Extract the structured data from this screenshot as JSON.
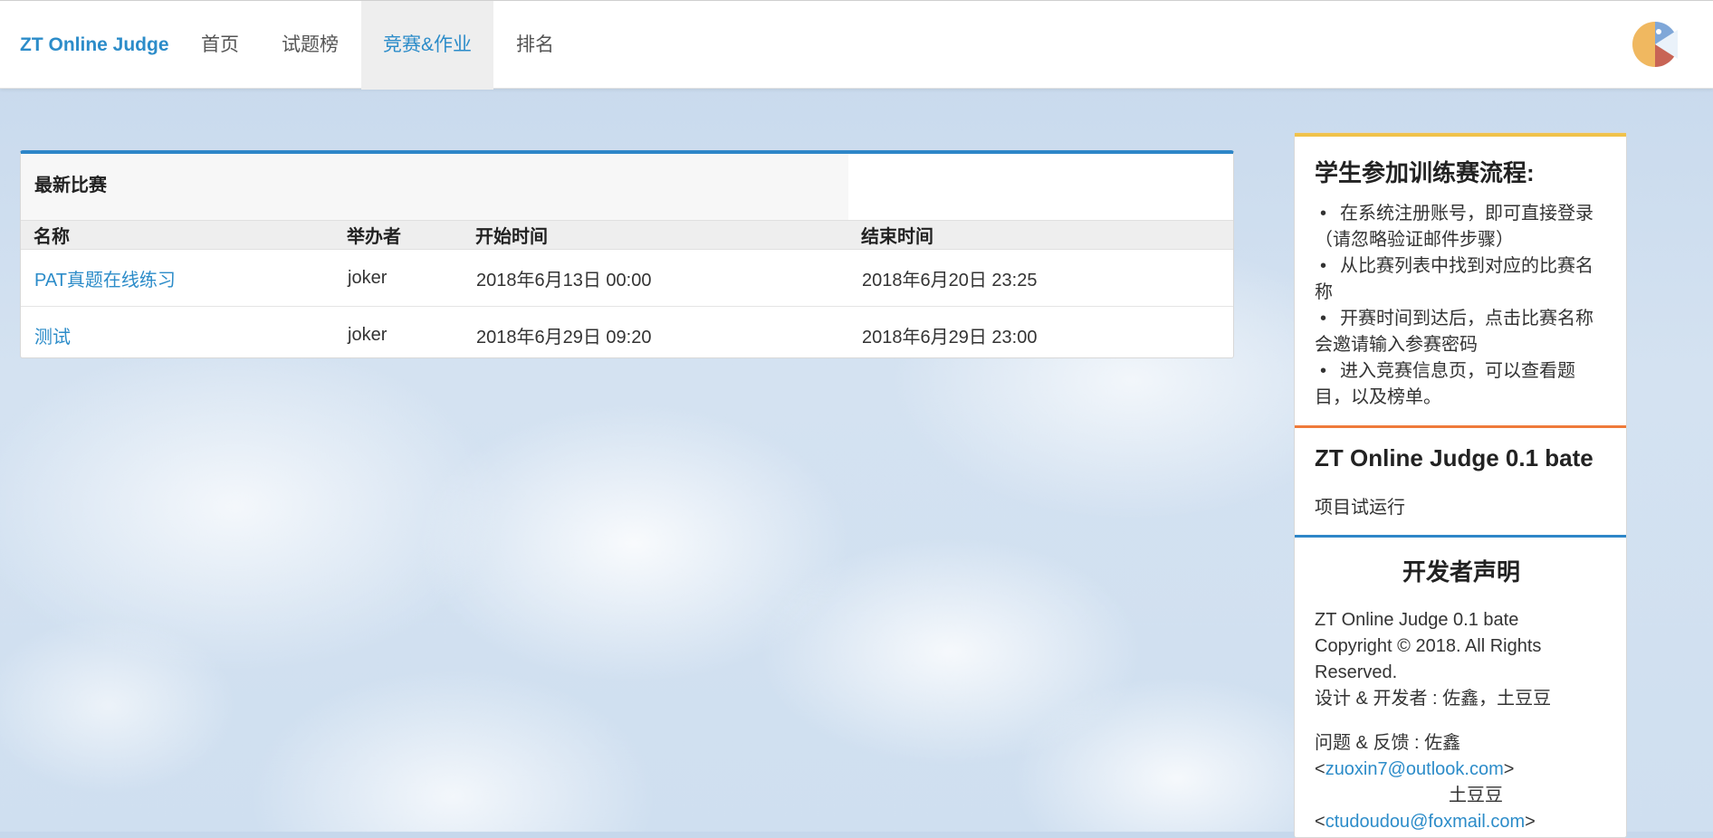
{
  "nav": {
    "brand": "ZT Online Judge",
    "items": [
      {
        "label": "首页"
      },
      {
        "label": "试题榜"
      },
      {
        "label": "竞赛&作业"
      },
      {
        "label": "排名"
      }
    ]
  },
  "contests": {
    "heading": "最新比赛",
    "columns": [
      "名称",
      "举办者",
      "开始时间",
      "结束时间"
    ],
    "rows": [
      {
        "name": "PAT真题在线练习",
        "host": "joker",
        "start": "2018年6月13日 00:00",
        "end": "2018年6月20日 23:25"
      },
      {
        "name": "测试",
        "host": "joker",
        "start": "2018年6月29日 09:20",
        "end": "2018年6月29日 23:00"
      }
    ]
  },
  "sidebar": {
    "process": {
      "title": "学生参加训练赛流程:",
      "steps": [
        "在系统注册账号，即可直接登录（请忽略验证邮件步骤）",
        "从比赛列表中找到对应的比赛名称",
        "开赛时间到达后，点击比赛名称会邀请输入参赛密码",
        "进入竞赛信息页，可以查看题目，以及榜单。"
      ]
    },
    "version": {
      "title": "ZT Online Judge 0.1 bate",
      "text": "项目试运行"
    },
    "developer": {
      "title": "开发者声明",
      "line1": "ZT Online Judge 0.1 bate",
      "line2": "Copyright © 2018. All Rights Reserved.",
      "line3": "设计 & 开发者 : 佐鑫，土豆豆",
      "feedback_label": "问题 & 反馈 : 佐鑫",
      "email1": "zuoxin7@outlook.com",
      "name2": "土豆豆",
      "email2": "ctudoudou@foxmail.com"
    }
  },
  "colors": {
    "accent": "#2c8cc9",
    "panel_border": "#2e86c8",
    "section_yellow": "#f0c24a",
    "section_orange": "#ef7a3a"
  },
  "icons": {
    "avatar": "pacman-avatar-icon"
  }
}
